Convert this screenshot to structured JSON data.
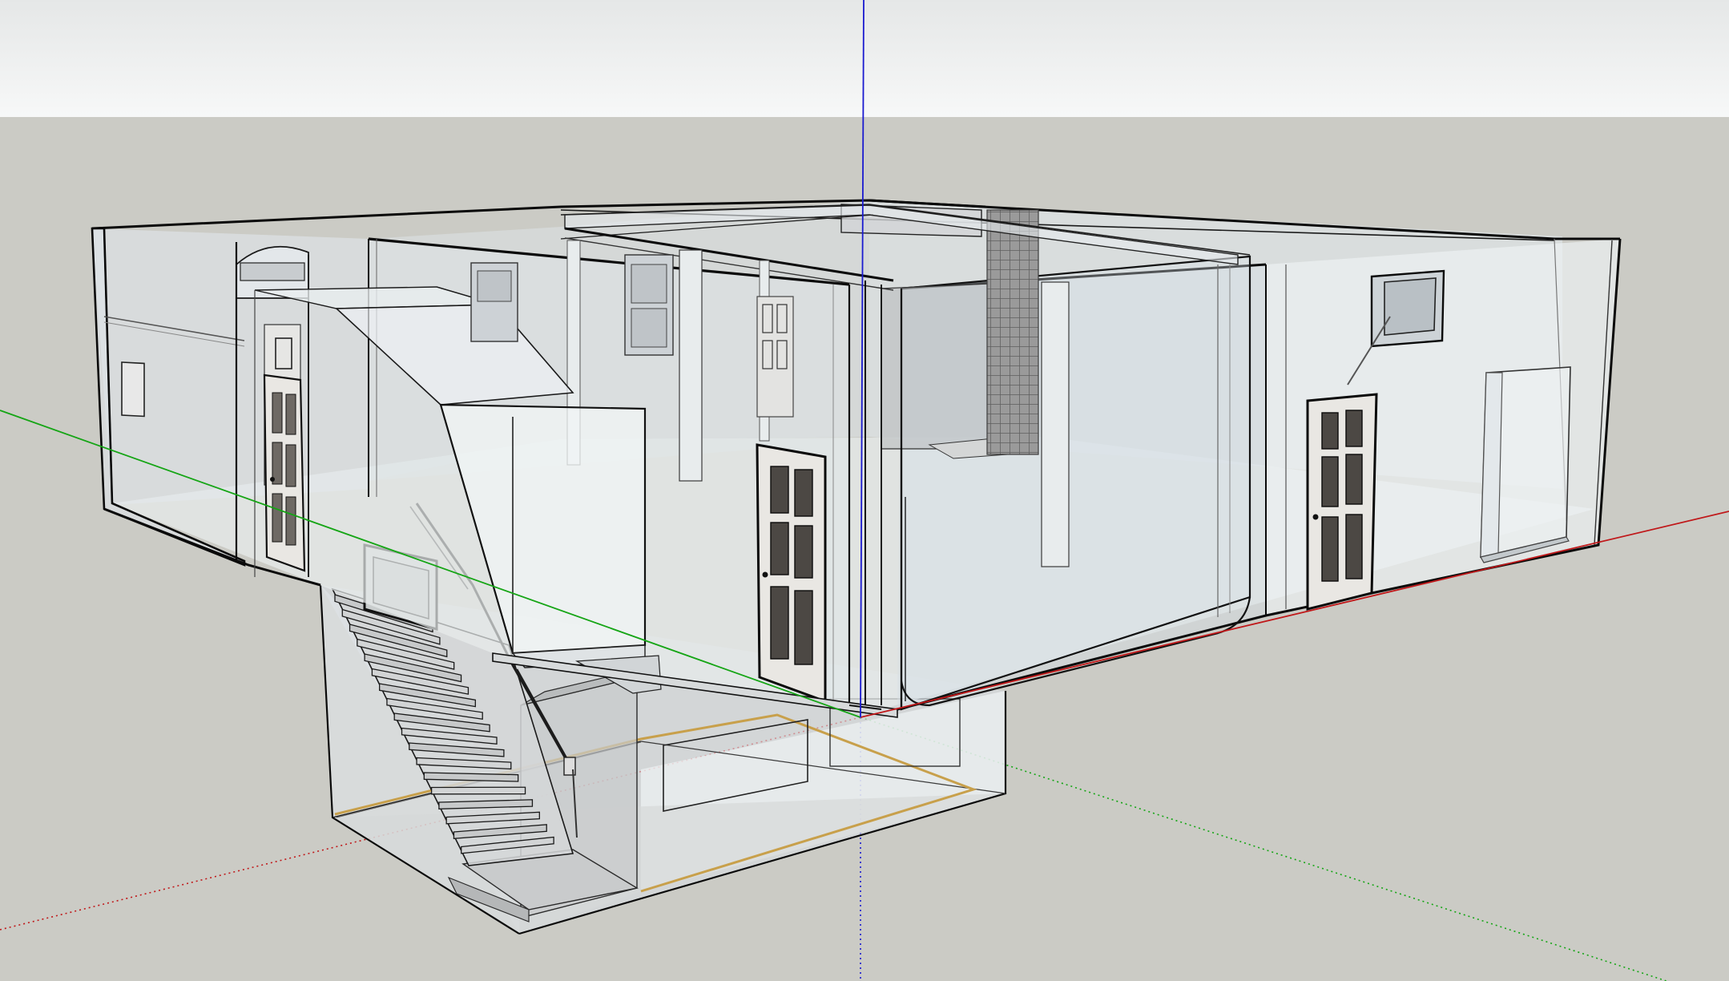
{
  "app": {
    "view": "3d-modeling-viewport",
    "render_style": "x-ray"
  },
  "colors": {
    "sky_top": "#e6e8e8",
    "sky_bottom": "#f6f7f7",
    "ground": "#cbcbc5",
    "axis_x": "#c0181a",
    "axis_y": "#15a515",
    "axis_z": "#1a1ad0",
    "glass": "#e6edf1",
    "glass_dark": "#c9cfd3",
    "edge": "#0a0a0a",
    "door_panel": "#e9e7e3",
    "door_inset": "#4c4844",
    "trim_gold": "#c8a04b",
    "stair": "#dcdcdc",
    "chimney_grid": "#6e6e6e"
  },
  "model": {
    "components": [
      "upper-floor-shell",
      "basement-box",
      "staircase",
      "door-center",
      "door-right",
      "door-left",
      "window-right",
      "window-back-left",
      "window-basement",
      "chimney",
      "columns",
      "partition-wall",
      "closet-box",
      "landing-box"
    ]
  }
}
